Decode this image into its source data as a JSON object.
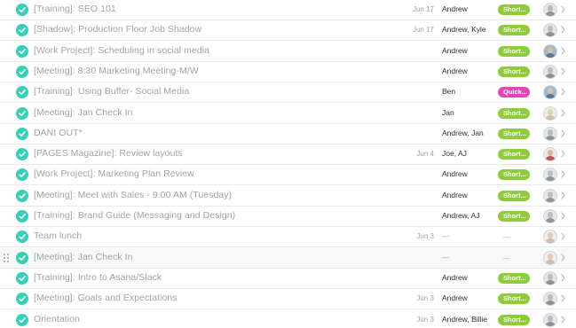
{
  "colors": {
    "check": "#35d0b5",
    "tag_short": "#8fcc3b",
    "tag_quick": "#e445b5"
  },
  "tasks": [
    {
      "name": "[Training]: SEO 101",
      "due": "Jun 17",
      "assignee": "Andrew",
      "tag": "Short...",
      "tag_color": "#8fcc3b",
      "avatar": "person-gray"
    },
    {
      "name": "[Shadow]: Production Floor Job Shadow",
      "due": "Jun 17",
      "assignee": "Andrew, Kyle",
      "tag": "Short...",
      "tag_color": "#8fcc3b",
      "avatar": "person-gray"
    },
    {
      "name": "[Work Project]: Scheduling in social media",
      "due": "",
      "assignee": "Andrew",
      "tag": "Short...",
      "tag_color": "#8fcc3b",
      "avatar": "person-blue"
    },
    {
      "name": "[Meeting]: 8:30 Marketing Meeting-M/W",
      "due": "",
      "assignee": "Andrew",
      "tag": "Short...",
      "tag_color": "#8fcc3b",
      "avatar": "person-gray"
    },
    {
      "name": "[Training]: Using Buffer- Social Media",
      "due": "",
      "assignee": "Ben",
      "tag": "Quick...",
      "tag_color": "#e445b5",
      "avatar": "person-blue"
    },
    {
      "name": "[Meeting]: Jan Check In",
      "due": "",
      "assignee": "Jan",
      "tag": "Short...",
      "tag_color": "#8fcc3b",
      "avatar": "person-light"
    },
    {
      "name": "DANI OUT*",
      "due": "",
      "assignee": "Andrew, Jan",
      "tag": "Short...",
      "tag_color": "#8fcc3b",
      "avatar": "person-gray"
    },
    {
      "name": "[PAGES Magazine]: Review layouts",
      "due": "Jun 4",
      "assignee": "Joe, AJ",
      "tag": "Short...",
      "tag_color": "#8fcc3b",
      "avatar": "person-red"
    },
    {
      "name": "[Work Project]: Marketing Plan Review",
      "due": "",
      "assignee": "Andrew",
      "tag": "Short...",
      "tag_color": "#8fcc3b",
      "avatar": "person-gray"
    },
    {
      "name": "[Meeting]: Meet with Sales - 9:00 AM (Tuesday)",
      "due": "",
      "assignee": "Andrew",
      "tag": "Short...",
      "tag_color": "#8fcc3b",
      "avatar": "person-gray"
    },
    {
      "name": "[Training]: Brand Guide (Messaging and Design)",
      "due": "",
      "assignee": "Andrew, AJ",
      "tag": "Short...",
      "tag_color": "#8fcc3b",
      "avatar": "person-gray"
    },
    {
      "name": "Team lunch",
      "due": "Jun 3",
      "assignee": "—",
      "tag": "—",
      "tag_color": "",
      "avatar": "person-light"
    },
    {
      "name": "[Meeting]: Jan Check In",
      "due": "",
      "assignee": "—",
      "tag": "—",
      "tag_color": "",
      "avatar": "person-light",
      "hover": true
    },
    {
      "name": "[Training]: Intro to Asana/Slack",
      "due": "",
      "assignee": "Andrew",
      "tag": "Short...",
      "tag_color": "#8fcc3b",
      "avatar": "person-gray"
    },
    {
      "name": "[Meeting]: Goals and Expectations",
      "due": "Jun 3",
      "assignee": "Andrew",
      "tag": "Short...",
      "tag_color": "#8fcc3b",
      "avatar": "person-gray"
    },
    {
      "name": "Orientation",
      "due": "Jun 3",
      "assignee": "Andrew, Billie",
      "tag": "Short...",
      "tag_color": "#8fcc3b",
      "avatar": "person-gray"
    }
  ]
}
